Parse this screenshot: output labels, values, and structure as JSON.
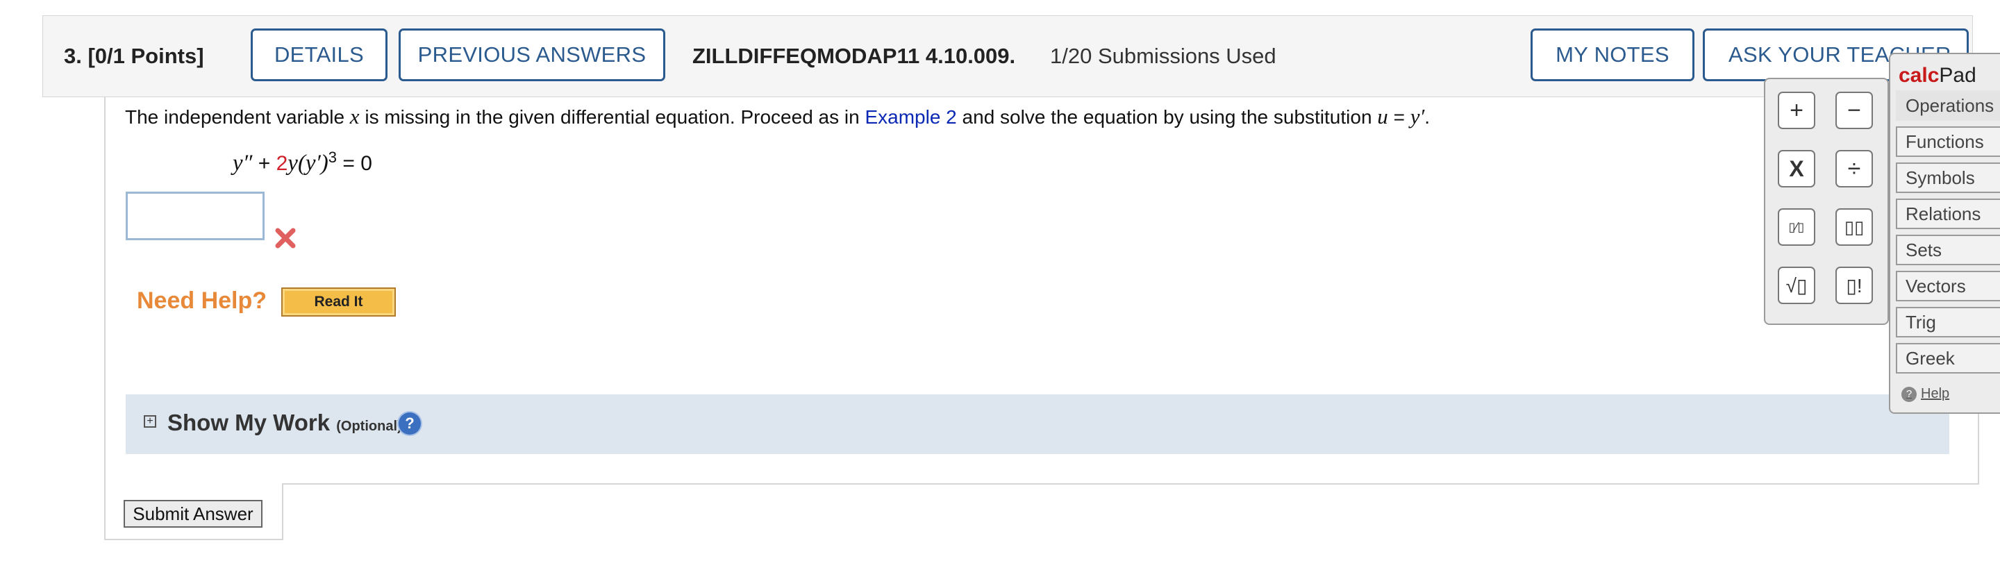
{
  "header": {
    "question_points": "3.  [0/1 Points]",
    "details_label": "DETAILS",
    "previous_answers_label": "PREVIOUS ANSWERS",
    "question_code": "ZILLDIFFEQMODAP11 4.10.009.",
    "submissions": "1/20 Submissions Used",
    "my_notes_label": "MY NOTES",
    "ask_teacher_label": "ASK YOUR TEACHER"
  },
  "question": {
    "prompt_1": "The independent variable ",
    "var_x": "x",
    "prompt_2": " is missing in the given differential equation. Proceed as in ",
    "example_link": "Example 2",
    "prompt_3": " and solve the equation by using the substitution ",
    "var_u": "u",
    "prompt_4": " = ",
    "var_yprime": "y′",
    "prompt_end": ".",
    "equation": {
      "term1": "y″",
      "plus": " + ",
      "coef": "2",
      "term2": "y(y′)",
      "exponent": "3",
      "rhs": " = 0"
    },
    "answer_value": "",
    "answer_status": "incorrect"
  },
  "help": {
    "need_help": "Need Help?",
    "read_it": "Read It"
  },
  "show_my_work": {
    "title": "Show My Work",
    "optional": "(Optional)",
    "help_glyph": "?"
  },
  "submit_label": "Submit Answer",
  "calcpad": {
    "logo_calc": "calc",
    "logo_pad": "Pad",
    "keys": {
      "plus": "+",
      "minus": "−",
      "times": "X",
      "divide": "÷",
      "fraction": "▯⁄▯",
      "power": "▯▯",
      "sqrt": "√▯",
      "factorial": "▯!"
    },
    "categories": [
      "Operations",
      "Functions",
      "Symbols",
      "Relations",
      "Sets",
      "Vectors",
      "Trig",
      "Greek"
    ],
    "help_label": "Help",
    "help_glyph": "?"
  },
  "colors": {
    "accent": "#2a5a8e",
    "link": "#0a28b4",
    "need_help": "#e8893a",
    "incorrect": "#e06060"
  }
}
